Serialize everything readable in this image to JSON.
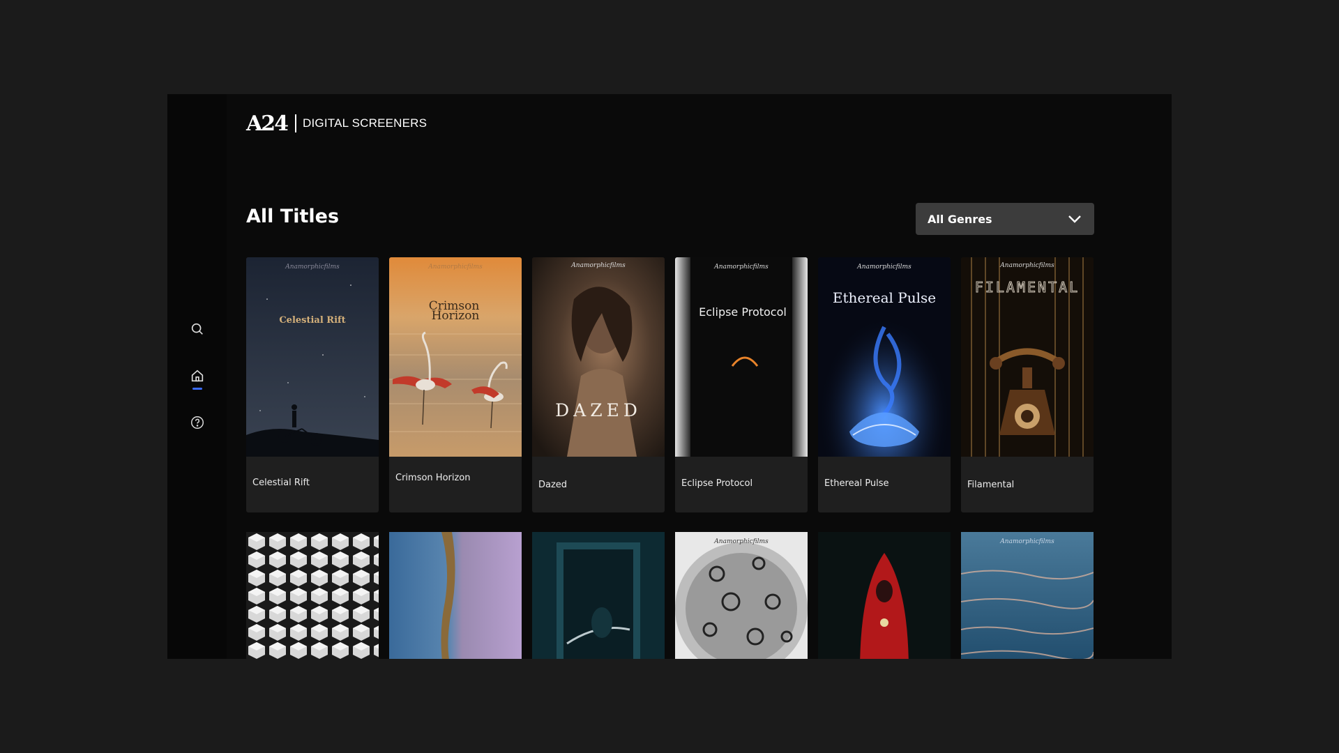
{
  "header": {
    "logo_mark": "A24",
    "logo_text": "DIGITAL SCREENERS"
  },
  "sidebar": {
    "items": [
      {
        "name": "search",
        "icon": "search-icon"
      },
      {
        "name": "home",
        "icon": "home-icon",
        "active": true
      },
      {
        "name": "help",
        "icon": "help-icon"
      }
    ],
    "accent": "#3b6cff"
  },
  "main": {
    "title": "All Titles",
    "genre_filter": {
      "selected": "All Genres",
      "icon": "chevron-down-icon"
    }
  },
  "posters": {
    "brand": "Anamorphicfilms",
    "celestial_rift": "Celestial Rift",
    "crimson_horizon_1": "Crimson",
    "crimson_horizon_2": "Horizon",
    "dazed": "DAZED",
    "eclipse_protocol": "Eclipse Protocol",
    "ethereal_pulse": "Ethereal Pulse",
    "filamental": "FILAMENTAL"
  },
  "titles": [
    {
      "title": "Celestial Rift"
    },
    {
      "title": "Crimson Horizon"
    },
    {
      "title": "Dazed"
    },
    {
      "title": "Eclipse Protocol"
    },
    {
      "title": "Ethereal Pulse"
    },
    {
      "title": "Filamental"
    }
  ],
  "colors": {
    "page_bg": "#1b1b1b",
    "app_bg": "#0a0a0a",
    "card_bg": "#1f1f1f",
    "select_bg": "#3c3c3c"
  }
}
